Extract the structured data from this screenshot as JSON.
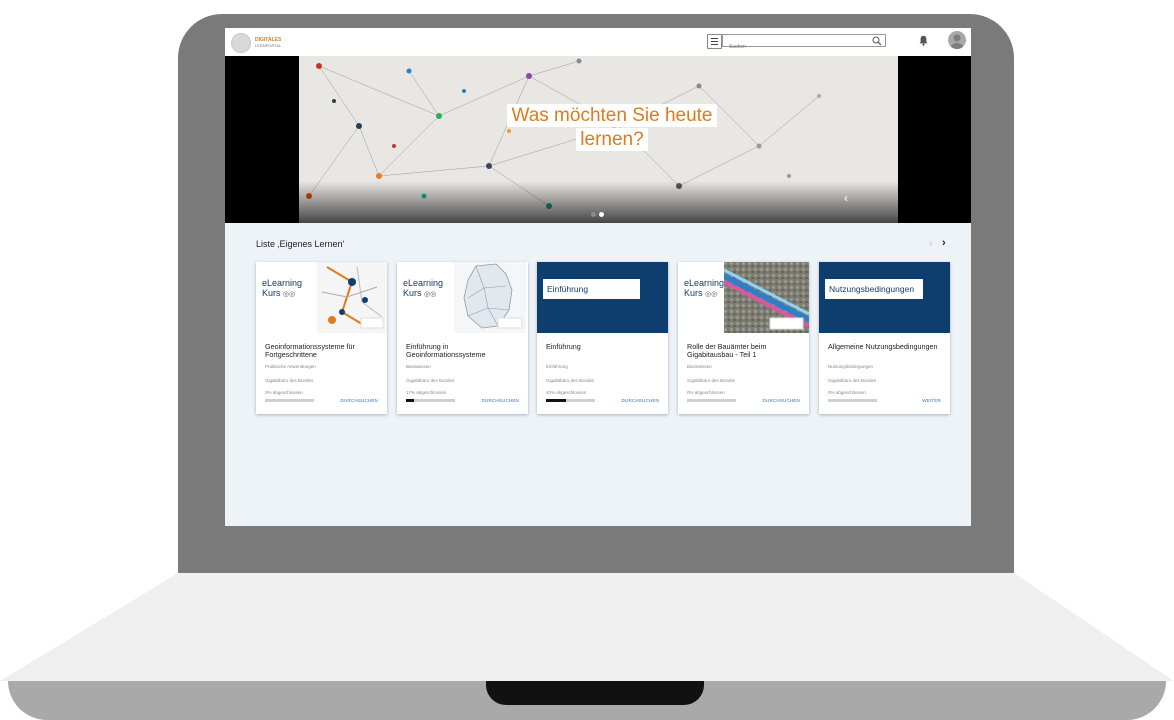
{
  "header": {
    "logo_line1": "DIGITALES",
    "logo_line2": "LERNPORTAL",
    "search_placeholder": "Suchen"
  },
  "hero": {
    "title_line1": "Was möchten Sie heute",
    "title_line2": "lernen?",
    "slides": 2,
    "active_slide": 2,
    "accent_color": "#e07a1c"
  },
  "list": {
    "title": "Liste ‚Eigenes Lernen‘",
    "cards": [
      {
        "image_type": "elearning",
        "image_l1": "eLearning",
        "image_l2": "Kurs",
        "title": "Geoinformationssysteme für Fortgeschrittene",
        "subtitle": "Praktische Anwendungen",
        "source": "Gigabitbüro des Bundes",
        "progress_text": "0% abgeschlossen",
        "progress": 0,
        "action": "DURCHSUCHEN"
      },
      {
        "image_type": "elearning",
        "image_l1": "eLearning",
        "image_l2": "Kurs",
        "title": "Einführung in Geoinformationssysteme",
        "subtitle": "Basiswissen",
        "source": "Gigabitbüro des Bundes",
        "progress_text": "17% abgeschlossen",
        "progress": 17,
        "action": "DURCHSUCHEN"
      },
      {
        "image_type": "blue",
        "image_label": "Einführung",
        "title": "Einführung",
        "subtitle": "Einführung",
        "source": "Gigabitbüro des Bundes",
        "progress_text": "40% abgeschlossen",
        "progress": 40,
        "action": "DURCHSUCHEN"
      },
      {
        "image_type": "elearning",
        "image_l1": "eLearning",
        "image_l2": "Kurs",
        "title": "Rolle der Bauämter beim Gigabitausbau - Teil 1",
        "subtitle": "Basiswissen",
        "source": "Gigabitbüro des Bundes",
        "progress_text": "0% abgeschlossen",
        "progress": 0,
        "action": "DURCHSUCHEN"
      },
      {
        "image_type": "blue",
        "image_label": "Nutzungsbedingungen",
        "title": "Allgemeine Nutzungsbedingungen",
        "subtitle": "Nutzungsbedingungen",
        "source": "Gigabitbüro des Bundes",
        "progress_text": "0% abgeschlossen",
        "progress": 0,
        "action": "WEITER"
      }
    ]
  },
  "colors": {
    "brand_blue": "#0e3e6e",
    "link_blue": "#2f6fb5",
    "page_bg": "#eef3f8"
  }
}
